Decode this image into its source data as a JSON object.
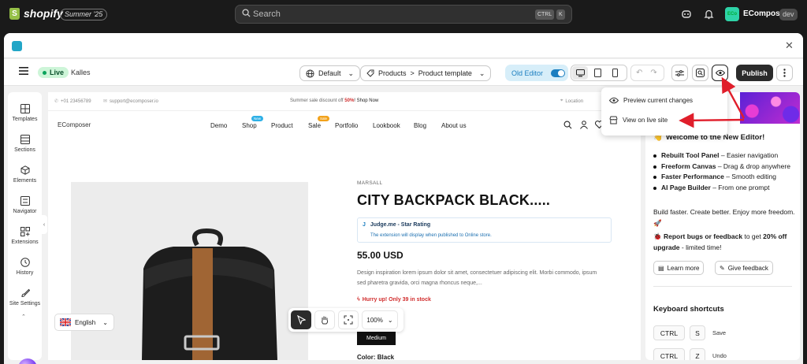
{
  "shopify": {
    "brand": "shopify",
    "edition": "Summer '25",
    "search_placeholder": "Search",
    "kbd_ctrl": "CTRL",
    "kbd_k": "K",
    "avatar_initials": "ECo",
    "store_name": "EComposer",
    "store_badge": "dev"
  },
  "toolbar": {
    "status": "Live",
    "theme": "Kalles",
    "template_select": "Default",
    "breadcrumb_products": "Products",
    "breadcrumb_sep": ">",
    "breadcrumb_template": "Product template",
    "old_editor": "Old Editor",
    "publish": "Publish"
  },
  "sidebar": {
    "items": [
      {
        "label": "Templates"
      },
      {
        "label": "Sections"
      },
      {
        "label": "Elements"
      },
      {
        "label": "Navigator"
      },
      {
        "label": "Extensions"
      },
      {
        "label": "History"
      },
      {
        "label": "Site Settings"
      }
    ]
  },
  "preview": {
    "phone": "+01 23456789",
    "email": "support@ecomposer.io",
    "announcement_prefix": "Summer sale discount off ",
    "announcement_percent": "50%",
    "announcement_link": "! Shop Now",
    "location": "Location",
    "logo": "EComposer",
    "nav": [
      "Demo",
      "Shop",
      "Product",
      "Sale",
      "Portfolio",
      "Lookbook",
      "Blog",
      "About us"
    ],
    "badge_new": "New",
    "badge_sale": "Sale",
    "vendor": "MARSALL",
    "title": "CITY BACKPACK BLACK.....",
    "judge_title": "Judge.me - Star Rating",
    "judge_note": "The extension will display when published to Online store.",
    "price": "55.00 USD",
    "description": "Design inspiration lorem ipsum dolor sit amet, consectetuer adipiscing elit. Morbi commodo, ipsum sed pharetra gravida, orci magna rhoncus neque,...",
    "hurry": "Hurry up! Only 39 in stock",
    "size_selected": "Medium",
    "color_label": "Color: Black",
    "language": "English",
    "zoom": "100%"
  },
  "dropdown": {
    "preview_changes": "Preview current changes",
    "view_live": "View on live site"
  },
  "panel": {
    "welcome": "Welcome to the New Editor!",
    "features": [
      {
        "bold": "Rebuilt Tool Panel",
        "rest": " – Easier navigation"
      },
      {
        "bold": "Freeform Canvas",
        "rest": " – Drag & drop anywhere"
      },
      {
        "bold": "Faster Performance",
        "rest": " – Smooth editing"
      },
      {
        "bold": "AI Page Builder",
        "rest": " – From one prompt"
      }
    ],
    "build": "Build faster. Create better. Enjoy more freedom.",
    "bugs_bold": "Report bugs or feedback",
    "bugs_mid": " to get ",
    "bugs_bold2": "20% off upgrade",
    "bugs_rest": " - limited time!",
    "learn_more": "Learn more",
    "give_feedback": "Give feedback",
    "shortcuts_title": "Keyboard shortcuts",
    "shortcuts": [
      {
        "k1": "CTRL",
        "k2": "S",
        "label": "Save"
      },
      {
        "k1": "CTRL",
        "k2": "Z",
        "label": "Undo"
      }
    ]
  },
  "colors": {
    "arrow": "#e01e2b",
    "publish": "#2b2b2b",
    "live": "#0aa35b",
    "accent": "#1b7ec0"
  }
}
